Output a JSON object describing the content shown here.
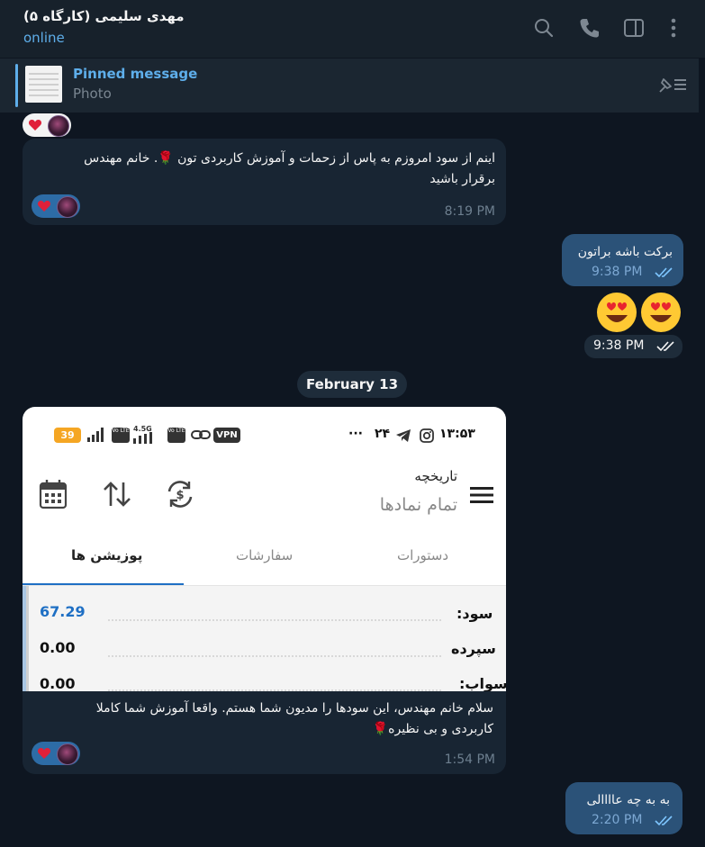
{
  "header": {
    "title": "مهدی سلیمی (کارگاه ۵)",
    "status": "online",
    "icons": [
      "search-icon",
      "phone-icon",
      "sidebar-icon",
      "more-icon"
    ]
  },
  "pinned": {
    "title": "Pinned message",
    "subtitle": "Photo"
  },
  "messages": [
    {
      "direction": "incoming",
      "text_line1": "اینم از سود امروزم به پاس از زحمات و آموزش کاربردی تون 🌹. خانم مهندس",
      "text_line2": "برقرار باشید",
      "time": "8:19 PM",
      "reaction": "heart"
    },
    {
      "direction": "outgoing",
      "text": "برکت باشه براتون",
      "time": "9:38 PM",
      "status": "read"
    },
    {
      "direction": "outgoing",
      "type": "emoji",
      "emoji": [
        "heart-eyes",
        "heart-eyes"
      ],
      "time": "9:38 PM",
      "status": "read"
    },
    {
      "direction": "incoming",
      "type": "photo",
      "caption_line1": "سلام خانم مهندس، این سودها را مدیون شما هستم. واقعا آموزش شما کاملا",
      "caption_line2": "کاربردی و بی نظیره🌹",
      "time": "1:54 PM",
      "reaction": "heart"
    },
    {
      "direction": "outgoing",
      "text": "به به چه عاااالی",
      "time": "2:20 PM",
      "status": "read"
    }
  ],
  "date_separator": "February 13",
  "photo": {
    "statusbar_left": "۱۳:۵۳",
    "statusbar_mid": "۲۴",
    "statusbar_dots": "···",
    "battery": "39",
    "net_label": "4.5G",
    "vpn": "VPN",
    "volte": "Vo LTE",
    "page_title": "تاریخچه",
    "page_subtitle": "تمام نمادها",
    "tabs": [
      "دستورات",
      "سفارشات",
      "پوزیشن ها"
    ],
    "active_tab": "پوزیشن ها",
    "rows": [
      {
        "label": "سود:",
        "value": "67.29",
        "color": "#1e6fc4"
      },
      {
        "label": "سپرده",
        "value": "0.00",
        "color": "#111111"
      },
      {
        "label": "سواب:",
        "value": "0.00",
        "color": "#111111"
      }
    ]
  },
  "colors": {
    "background": "#0e1621",
    "header": "#17212b",
    "incoming_bubble": "#182533",
    "outgoing_bubble": "#2b5278",
    "accent": "#5eaeea",
    "profit_value": "#1e6fc4"
  }
}
